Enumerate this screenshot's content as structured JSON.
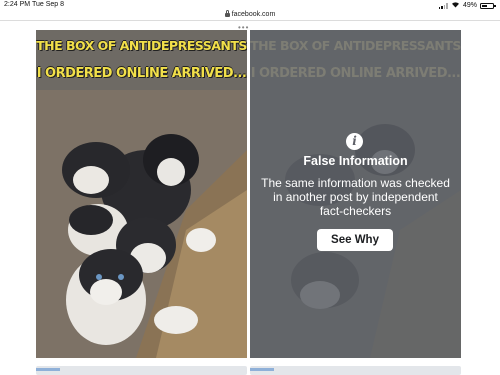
{
  "status_bar": {
    "time": "2:24 PM",
    "date": "Tue Sep 8",
    "battery": "49%",
    "battery_level": 0.49,
    "wifi_icon": "wifi-icon"
  },
  "browser": {
    "url": "facebook.com",
    "lock_icon": "lock-icon"
  },
  "post": {
    "caption_line1": "THE BOX OF ANTIDEPRESSANTS",
    "caption_line2": "I ORDERED ONLINE ARRIVED..."
  },
  "fact_check": {
    "icon": "info-icon",
    "title": "False Information",
    "body": "The same information was checked in another post by independent fact-checkers",
    "button_label": "See Why"
  },
  "colors": {
    "caption_yellow": "#f2e04a",
    "overlay_gray": "#6b6e74",
    "button_white": "#ffffff"
  }
}
